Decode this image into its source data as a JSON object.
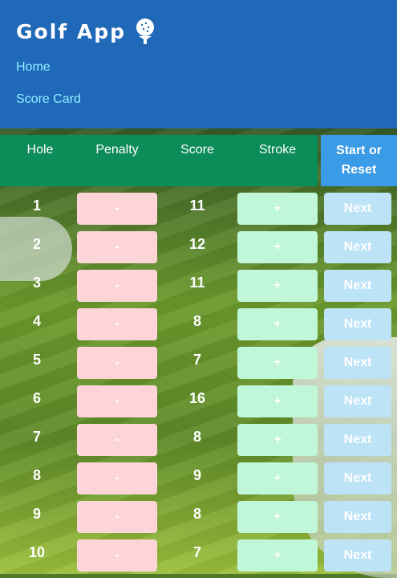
{
  "app": {
    "title": "Golf App",
    "icon": "golf-ball-on-tee-icon"
  },
  "nav": {
    "home": "Home",
    "score_card": "Score Card"
  },
  "table": {
    "headers": {
      "hole": "Hole",
      "penalty": "Penalty",
      "score": "Score",
      "stroke": "Stroke",
      "start_reset": "Start or Reset"
    },
    "minus_label": "-",
    "plus_label": "+",
    "next_label": "Next",
    "rows": [
      {
        "hole": "1",
        "score": "11"
      },
      {
        "hole": "2",
        "score": "12"
      },
      {
        "hole": "3",
        "score": "11"
      },
      {
        "hole": "4",
        "score": "8"
      },
      {
        "hole": "5",
        "score": "7"
      },
      {
        "hole": "6",
        "score": "16"
      },
      {
        "hole": "7",
        "score": "8"
      },
      {
        "hole": "8",
        "score": "9"
      },
      {
        "hole": "9",
        "score": "8"
      },
      {
        "hole": "10",
        "score": "7"
      }
    ]
  },
  "colors": {
    "header_bg": "#2068b8",
    "nav_link": "#8ff0ff",
    "table_header": "#0c8c58",
    "start_button": "#3a9be6",
    "minus_button": "#fdd5d8",
    "plus_button": "#c0f7d8",
    "next_button": "#bde3f7"
  }
}
